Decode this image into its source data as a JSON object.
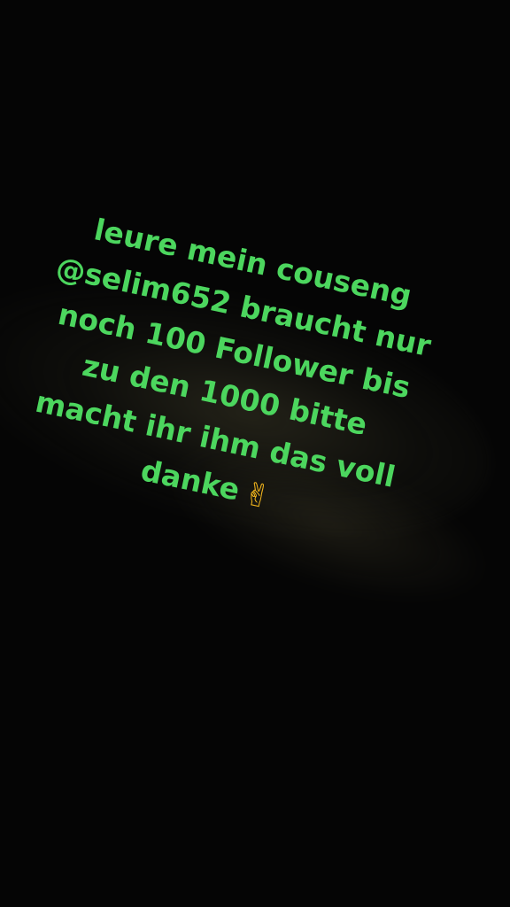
{
  "caption": {
    "lines": [
      "leure mein couseng",
      "@selim652 braucht nur",
      "noch 100 Follower bis",
      "zu  den 1000 bitte",
      "macht ihr ihm das voll",
      "danke"
    ],
    "emoji": "✌"
  },
  "colors": {
    "background": "#050505",
    "text": "#4cd65e",
    "emoji": "#f2b51c"
  }
}
